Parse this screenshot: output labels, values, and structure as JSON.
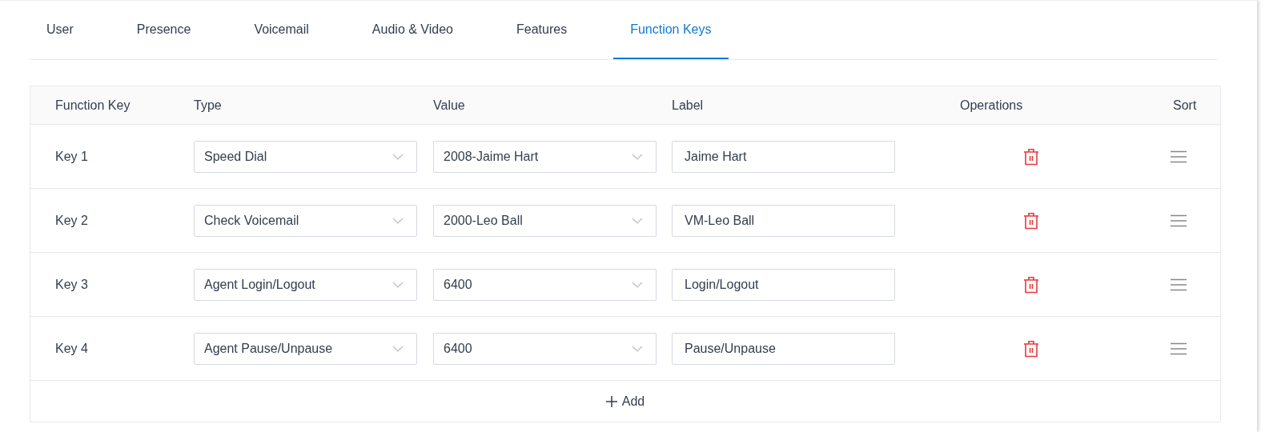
{
  "tabs": [
    {
      "label": "User",
      "selected": false
    },
    {
      "label": "Presence",
      "selected": false
    },
    {
      "label": "Voicemail",
      "selected": false
    },
    {
      "label": "Audio & Video",
      "selected": false
    },
    {
      "label": "Features",
      "selected": false
    },
    {
      "label": "Function Keys",
      "selected": true
    }
  ],
  "table": {
    "columns": [
      "Function Key",
      "Type",
      "Value",
      "Label",
      "Operations",
      "Sort"
    ],
    "rows": [
      {
        "key": "Key 1",
        "type": "Speed Dial",
        "value": "2008-Jaime Hart",
        "label": "Jaime Hart"
      },
      {
        "key": "Key 2",
        "type": "Check Voicemail",
        "value": "2000-Leo Ball",
        "label": "VM-Leo Ball"
      },
      {
        "key": "Key 3",
        "type": "Agent Login/Logout",
        "value": "6400",
        "label": "Login/Logout"
      },
      {
        "key": "Key 4",
        "type": "Agent Pause/Unpause",
        "value": "6400",
        "label": "Pause/Unpause"
      }
    ],
    "add_button": "Add"
  }
}
